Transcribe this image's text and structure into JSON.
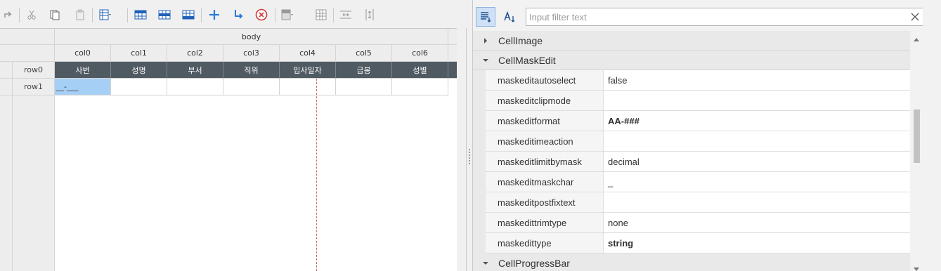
{
  "grid": {
    "body_label": "body",
    "columns": [
      "col0",
      "col1",
      "col2",
      "col3",
      "col4",
      "col5",
      "col6"
    ],
    "rows": [
      "row0",
      "row1"
    ],
    "row0_cells": [
      "사번",
      "성명",
      "부서",
      "직위",
      "입사일자",
      "급봉",
      "성별"
    ],
    "row1_mask_value": "__-___"
  },
  "filter": {
    "placeholder": "Input filter text"
  },
  "categories": {
    "cellimage": "CellImage",
    "cellmaskedit": "CellMaskEdit",
    "cellprogressbar": "CellProgressBar"
  },
  "properties": [
    {
      "name": "maskeditautoselect",
      "value": "false",
      "bold": false
    },
    {
      "name": "maskeditclipmode",
      "value": "",
      "bold": false
    },
    {
      "name": "maskeditformat",
      "value": "AA-###",
      "bold": true
    },
    {
      "name": "maskeditimeaction",
      "value": "",
      "bold": false
    },
    {
      "name": "maskeditlimitbymask",
      "value": "decimal",
      "bold": false
    },
    {
      "name": "maskeditmaskchar",
      "value": "_",
      "bold": false
    },
    {
      "name": "maskeditpostfixtext",
      "value": "",
      "bold": false
    },
    {
      "name": "maskedittrimtype",
      "value": "none",
      "bold": false
    },
    {
      "name": "maskedittype",
      "value": "string",
      "bold": true
    }
  ],
  "colors": {
    "header_dark": "#505a62",
    "mask_selection": "#a6cff5",
    "accent_blue": "#2a7bd6",
    "guide_red": "#d66a6a"
  },
  "icons": {
    "toolbar": [
      "redo-icon",
      "cut-icon",
      "copy-icon",
      "paste-icon",
      "column-layout-icon",
      "insert-row-above-icon",
      "insert-row-icon",
      "insert-row-below-icon",
      "add-icon",
      "add-child-icon",
      "delete-icon",
      "merge-cells-icon",
      "grid-icon",
      "col-resize-icon",
      "row-resize-icon"
    ],
    "panel": [
      "sort-category-icon",
      "sort-alpha-icon",
      "clear-icon",
      "scroll-up-icon",
      "scroll-down-icon"
    ]
  }
}
